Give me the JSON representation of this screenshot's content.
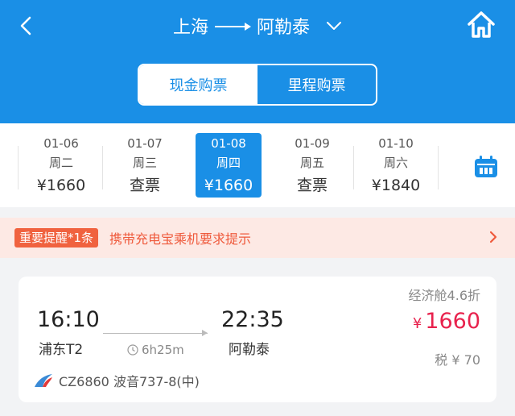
{
  "header": {
    "origin": "上海",
    "destination": "阿勒泰",
    "tabs": [
      {
        "label": "现金购票",
        "active": true
      },
      {
        "label": "里程购票",
        "active": false
      }
    ],
    "colors": {
      "primary": "#1a8fe6"
    }
  },
  "dates": [
    {
      "date": "01-06",
      "weekday": "周二",
      "price": "¥1660",
      "selected": false
    },
    {
      "date": "01-07",
      "weekday": "周三",
      "price": "查票",
      "selected": false
    },
    {
      "date": "01-08",
      "weekday": "周四",
      "price": "¥1660",
      "selected": true
    },
    {
      "date": "01-09",
      "weekday": "周五",
      "price": "查票",
      "selected": false
    },
    {
      "date": "01-10",
      "weekday": "周六",
      "price": "¥1840",
      "selected": false
    }
  ],
  "notice": {
    "tag": "重要提醒*1条",
    "message": "携带充电宝乘机要求提示"
  },
  "flight": {
    "dep_time": "16:10",
    "dep_airport": "浦东T2",
    "duration": "6h25m",
    "arr_time": "22:35",
    "arr_airport": "阿勒泰",
    "cabin": "经济舱4.6折",
    "currency": "¥",
    "price": "1660",
    "tax": "税 ¥ 70",
    "flight_info": "CZ6860 波音737-8(中)"
  },
  "icons": [
    "back-chevron-icon",
    "dropdown-chevron-icon",
    "home-icon",
    "calendar-icon",
    "chevron-right-icon",
    "clock-icon",
    "china-southern-logo-icon"
  ]
}
